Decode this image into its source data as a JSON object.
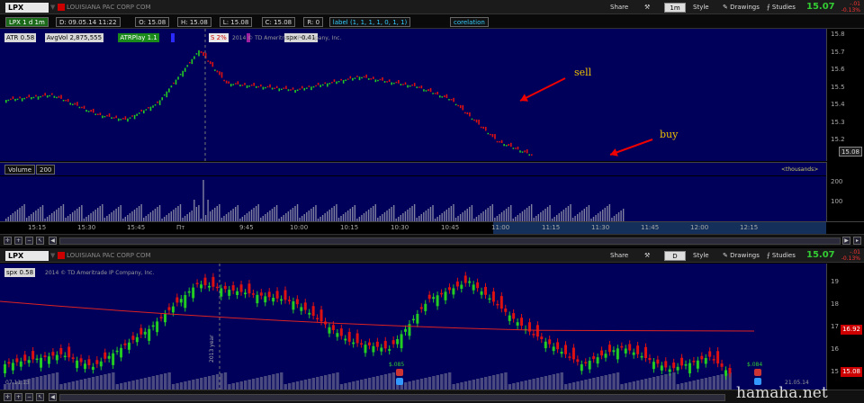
{
  "top": {
    "symbol": "LPX",
    "company": "LOUISIANA PAC CORP COM",
    "fields": [
      "LPX 1 d 1m",
      "D: 09.05.14 11:22",
      "O: 15.08",
      "H: 15.08",
      "L: 15.08",
      "C: 15.08",
      "R: 0",
      "label (1, 1, 1, 1, 0, 1, 1)",
      "corelation"
    ],
    "share": "Share",
    "tf": "1m",
    "style": "Style",
    "drawings": "Drawings",
    "studies": "Studies",
    "last": "15.07",
    "change": "-.01",
    "change_pct": "-0.13%"
  },
  "studies_row": [
    {
      "text": "ATR 0.58",
      "color": "#d8d8d8",
      "fg": "#000"
    },
    {
      "text": "AvgVol 2,875,555",
      "color": "#d8d8d8",
      "fg": "#000"
    },
    {
      "text": "ATRPlay 1.1",
      "color": "#1a8a1a",
      "fg": "#fff"
    },
    {
      "text": "",
      "color": "#2a2aff",
      "fg": "#fff"
    },
    {
      "text": "S 2%",
      "color": "#e8e8e8",
      "fg": "#c00"
    },
    {
      "text": "",
      "color": "#a020a0",
      "fg": "#fff"
    },
    {
      "text": "spx -0.41",
      "color": "#d8d8d8",
      "fg": "#000"
    }
  ],
  "copyright": "2014 © TD Ameritrade IP Company, Inc.",
  "price_axis": [
    "15.8",
    "15.7",
    "15.6",
    "15.5",
    "15.4",
    "15.3",
    "15.2"
  ],
  "price_tag": "15.08",
  "annotations": {
    "sell": "sell",
    "buy": "buy"
  },
  "volume": {
    "label": "Volume",
    "value": "200",
    "units": "<thousands>",
    "axis": [
      "200",
      "100"
    ]
  },
  "time_axis": [
    "15:15",
    "15:30",
    "15:45",
    "Пт",
    "9:45",
    "10:00",
    "10:15",
    "10:30",
    "10:45",
    "11:00",
    "11:15",
    "11:30",
    "11:45",
    "12:00",
    "12:15"
  ],
  "bottom": {
    "symbol": "LPX",
    "company": "LOUISIANA PAC CORP COM",
    "share": "Share",
    "tf": "D",
    "style": "Style",
    "drawings": "Drawings",
    "studies": "Studies",
    "last": "15.07",
    "change": "-.01",
    "change_pct": "-0.13%",
    "study": "spx 0.58",
    "axis": [
      "19",
      "18",
      "17",
      "16",
      "15"
    ],
    "tags": [
      "16.92",
      "15.08"
    ],
    "earnings1": "$.085",
    "earnings2": "$.084",
    "year_label": "2013 year",
    "date_left": "07.11.13",
    "date_right": "21.05.14"
  },
  "watermark": "hamaha.net",
  "colors": {
    "bg": "#00005a",
    "up": "#22cc22",
    "down": "#dd1111",
    "volume": "#8080a0"
  }
}
